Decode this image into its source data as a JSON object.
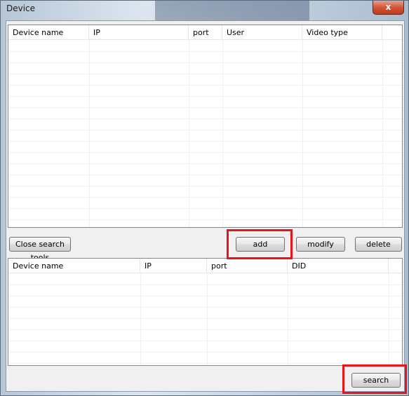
{
  "window": {
    "title": "Device",
    "close_label": "x"
  },
  "top_table": {
    "columns": [
      "Device name",
      "IP",
      "port",
      "User",
      "Video type"
    ],
    "rows": []
  },
  "toolbar": {
    "close_search_tools_label": "Close search tools",
    "add_label": "add",
    "modify_label": "modify",
    "delete_label": "delete"
  },
  "bottom_table": {
    "columns": [
      "Device name",
      "IP",
      "port",
      "DID"
    ],
    "rows": []
  },
  "footer": {
    "search_label": "search"
  },
  "colors": {
    "highlight": "#e8141c"
  }
}
